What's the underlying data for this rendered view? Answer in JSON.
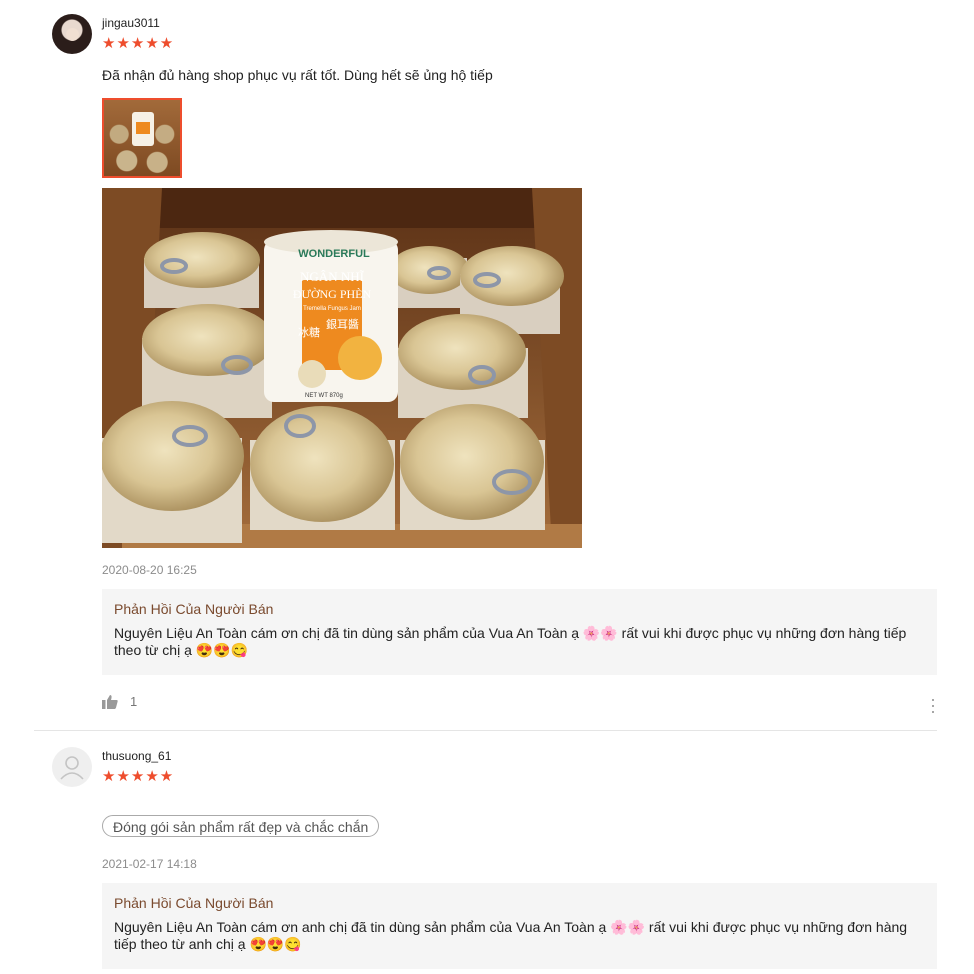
{
  "reviews": [
    {
      "username": "jingau3011",
      "stars": "★★★★★",
      "comment": "Đã nhận đủ hàng shop phục vụ rất tốt. Dùng hết sẽ ủng hộ tiếp",
      "timestamp": "2020-08-20 16:25",
      "reply_title": "Phản Hồi Của Người Bán",
      "reply_text": "Nguyên Liệu An Toàn cám ơn chị đã tin dùng sản phẩm của Vua An Toàn ạ 🌸🌸 rất vui khi được phục vụ những đơn hàng tiếp theo từ chị ạ 😍😍😋",
      "likes": "1",
      "photo": {
        "brand": "WONDERFUL",
        "title_line1": "NGÂN NHĨ",
        "title_line2": "ĐƯỜNG PHÈN",
        "subtitle": "Tremella Fungus Jam",
        "chinese_col1": "冰糖",
        "chinese_col2": "銀耳醬",
        "net_weight": "NET WT 870g"
      }
    },
    {
      "username": "thusuong_61",
      "stars": "★★★★★",
      "tag": "Đóng gói sản phẩm rất đẹp và chắc chắn",
      "timestamp": "2021-02-17 14:18",
      "reply_title": "Phản Hồi Của Người Bán",
      "reply_text": "Nguyên Liệu An Toàn cám ơn anh chị đã tin dùng sản phẩm của Vua An Toàn ạ 🌸🌸 rất vui khi được phục vụ những đơn hàng tiếp theo từ anh chị ạ 😍😍😋"
    }
  ],
  "colors": {
    "accent": "#ee4d2d",
    "reply_bg": "#f5f5f5",
    "reply_title": "#7a4a2e"
  }
}
